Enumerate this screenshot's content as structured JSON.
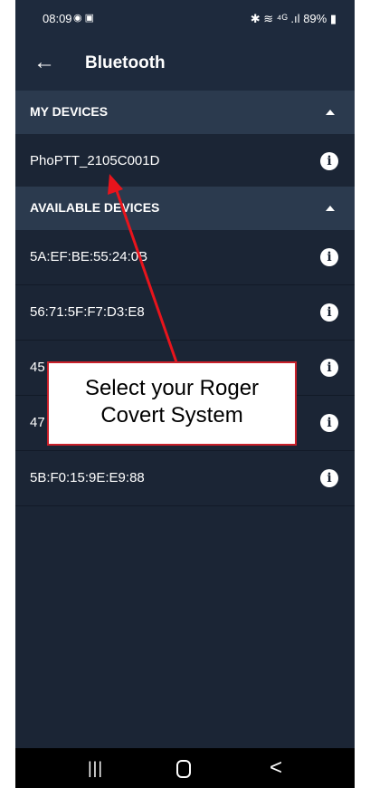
{
  "status_bar": {
    "time": "08:09",
    "icons_left": "◉ ▣",
    "icons_right": "✱ ≋ ⁴ᴳ .ıl",
    "battery": "89%"
  },
  "app_bar": {
    "back_icon": "←",
    "title": "Bluetooth"
  },
  "my_devices": {
    "header": "MY DEVICES",
    "devices": [
      {
        "name": "PhoPTT_2105C001D"
      }
    ]
  },
  "available_devices": {
    "header": "AVAILABLE DEVICES",
    "devices": [
      {
        "name": "5A:EF:BE:55:24:0B"
      },
      {
        "name": "56:71:5F:F7:D3:E8"
      },
      {
        "name": "45"
      },
      {
        "name": "47"
      },
      {
        "name": "5B:F0:15:9E:E9:88"
      }
    ]
  },
  "info_icon": "i",
  "nav_bar": {
    "recents_icon": "|||",
    "back_icon": "<"
  },
  "annotation": {
    "line1": "Select your Roger",
    "line2": "Covert System",
    "color": "#c9202a"
  }
}
